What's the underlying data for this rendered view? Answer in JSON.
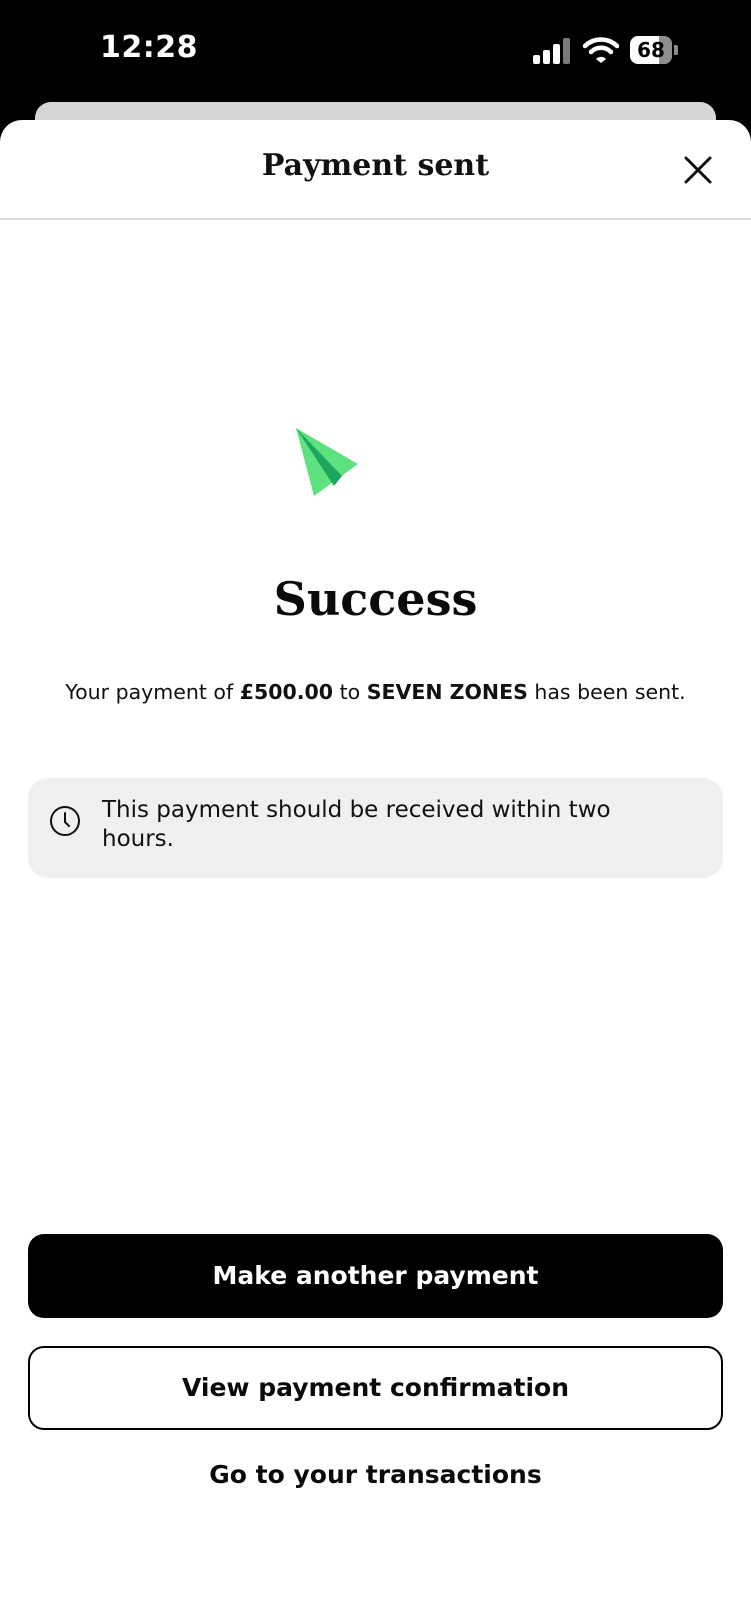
{
  "status_bar": {
    "time": "12:28",
    "battery_level": "68",
    "battery_fraction": 0.68
  },
  "header": {
    "title": "Payment sent",
    "close_icon": "close-icon"
  },
  "illustration": {
    "icon": "paper-plane-icon",
    "colors": {
      "light": "#5ee27f",
      "dark": "#1fa65e"
    }
  },
  "main": {
    "heading": "Success",
    "message": {
      "prefix": "Your payment of ",
      "amount": "£500.00",
      "middle": " to ",
      "payee": "SEVEN ZONES",
      "suffix": " has been sent."
    },
    "info": {
      "icon": "clock-icon",
      "text": "This payment should be received within two hours."
    }
  },
  "actions": {
    "primary": "Make another payment",
    "secondary": "View payment confirmation",
    "link": "Go to your transactions"
  }
}
